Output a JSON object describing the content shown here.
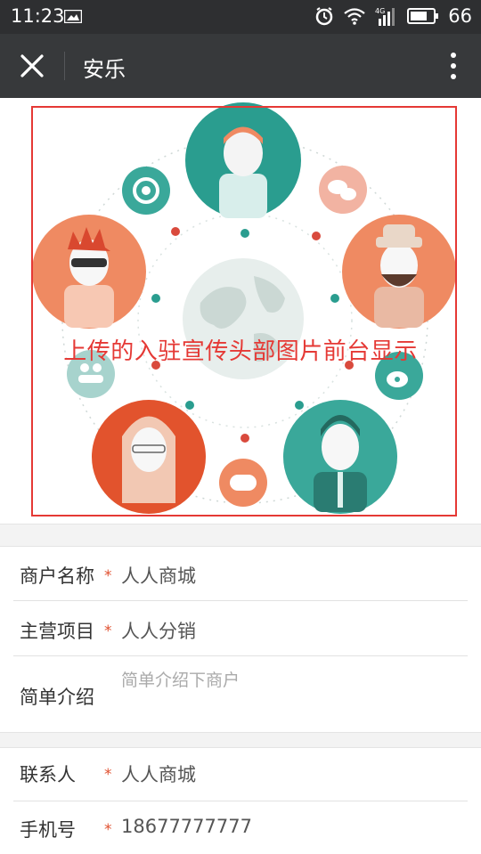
{
  "status_bar": {
    "time": "11:23",
    "battery": "66"
  },
  "nav": {
    "title": "安乐"
  },
  "banner": {
    "caption": "上传的入驻宣传头部图片前台显示"
  },
  "form": {
    "fields": [
      {
        "label": "商户名称",
        "required": "*",
        "value": "人人商城"
      },
      {
        "label": "主营项目",
        "required": "*",
        "value": "人人分销"
      },
      {
        "label": "简单介绍",
        "placeholder": "简单介绍下商户"
      },
      {
        "label": "联系人",
        "required": "*",
        "value": "人人商城"
      },
      {
        "label": "手机号",
        "required": "*",
        "value": "18677777777"
      }
    ]
  },
  "colors": {
    "nav_bg": "#37393b",
    "status_bg": "#2e2f31",
    "highlight_red": "#e53935",
    "required_star": "#e0502f",
    "teal": "#2a9d8f",
    "orange": "#ef8a62"
  }
}
